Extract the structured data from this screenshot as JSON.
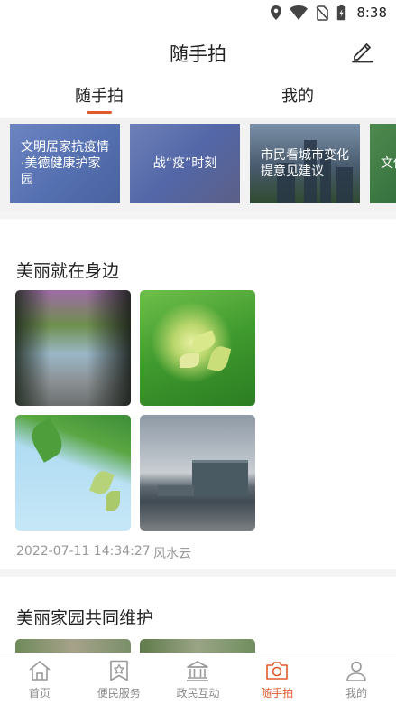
{
  "status_bar": {
    "time": "8:38",
    "icons": [
      "location-icon",
      "wifi-icon",
      "no-sim-icon",
      "battery-icon"
    ]
  },
  "header": {
    "title": "随手拍",
    "edit_icon": "pencil-icon"
  },
  "tabs": [
    {
      "label": "随手拍",
      "active": true
    },
    {
      "label": "我的",
      "active": false
    }
  ],
  "banners": [
    {
      "label": "文明居家抗疫情·美德健康护家园"
    },
    {
      "label": "战“疫”时刻"
    },
    {
      "label": "市民看城市变化提意见建议"
    },
    {
      "label": "文他"
    }
  ],
  "posts": [
    {
      "title": "美丽就在身边",
      "time": "2022-07-11 14:34:27",
      "author": "风水云"
    },
    {
      "title": "美丽家园共同维护"
    }
  ],
  "bottom_nav": [
    {
      "label": "首页",
      "icon": "home-icon",
      "active": false
    },
    {
      "label": "便民服务",
      "icon": "star-bookmark-icon",
      "active": false
    },
    {
      "label": "政民互动",
      "icon": "government-building-icon",
      "active": false
    },
    {
      "label": "随手拍",
      "icon": "camera-icon",
      "active": true
    },
    {
      "label": "我的",
      "icon": "user-icon",
      "active": false
    }
  ],
  "colors": {
    "accent": "#e05a2a",
    "muted_text": "#999999"
  }
}
